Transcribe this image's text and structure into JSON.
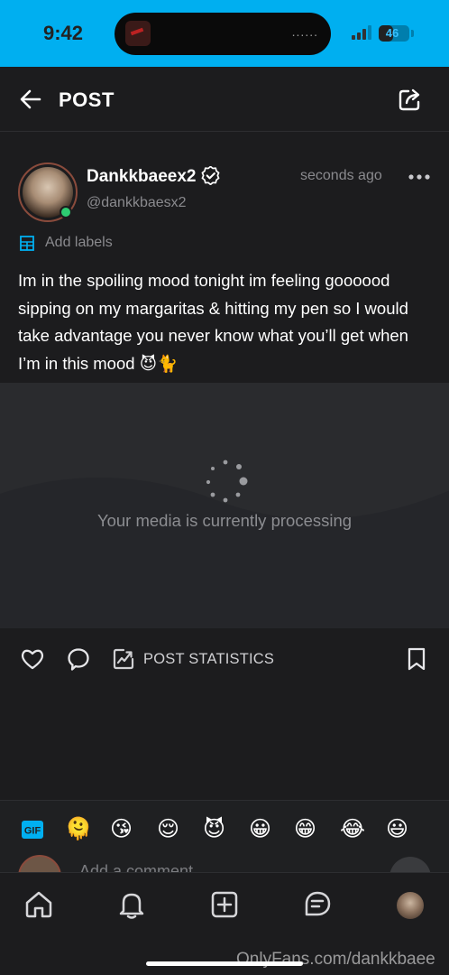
{
  "status_bar": {
    "time": "9:42",
    "battery": "46",
    "battery_level": 0.46,
    "island_dots": "......"
  },
  "header": {
    "title": "POST",
    "back_icon": "arrow-left-icon",
    "share_icon": "share-icon"
  },
  "post": {
    "display_name": "Dankkbaeex2",
    "username": "@dankkbaesx2",
    "timestamp": "seconds ago",
    "labels_text": "Add labels",
    "text_main": "Im in the spoiling mood tonight im feeling goooood sipping on my margaritas & hitting my pen so I would take advantage you never know what you’ll get when I’m in this mood ",
    "text_emoji": "😈🐈",
    "media_status": "Your media is currently processing"
  },
  "actions": {
    "stats_label": "POST STATISTICS"
  },
  "emoji_bar": {
    "emojis": [
      "🫠",
      "😘",
      "😌",
      "😈",
      "😀",
      "😁",
      "😂",
      "😃"
    ]
  },
  "comment": {
    "placeholder": "Add a comment..."
  },
  "nav": {
    "items": [
      "home-icon",
      "bell-icon",
      "add-post-icon",
      "messages-icon",
      "profile-avatar"
    ]
  },
  "watermark": "OnlyFans.com/dankkbaee",
  "colors": {
    "status_bar": "#00aff0",
    "background": "#1c1c1e",
    "media_placeholder": "#2a2b2e",
    "accent": "#00aff0",
    "online": "#2ecc71"
  }
}
